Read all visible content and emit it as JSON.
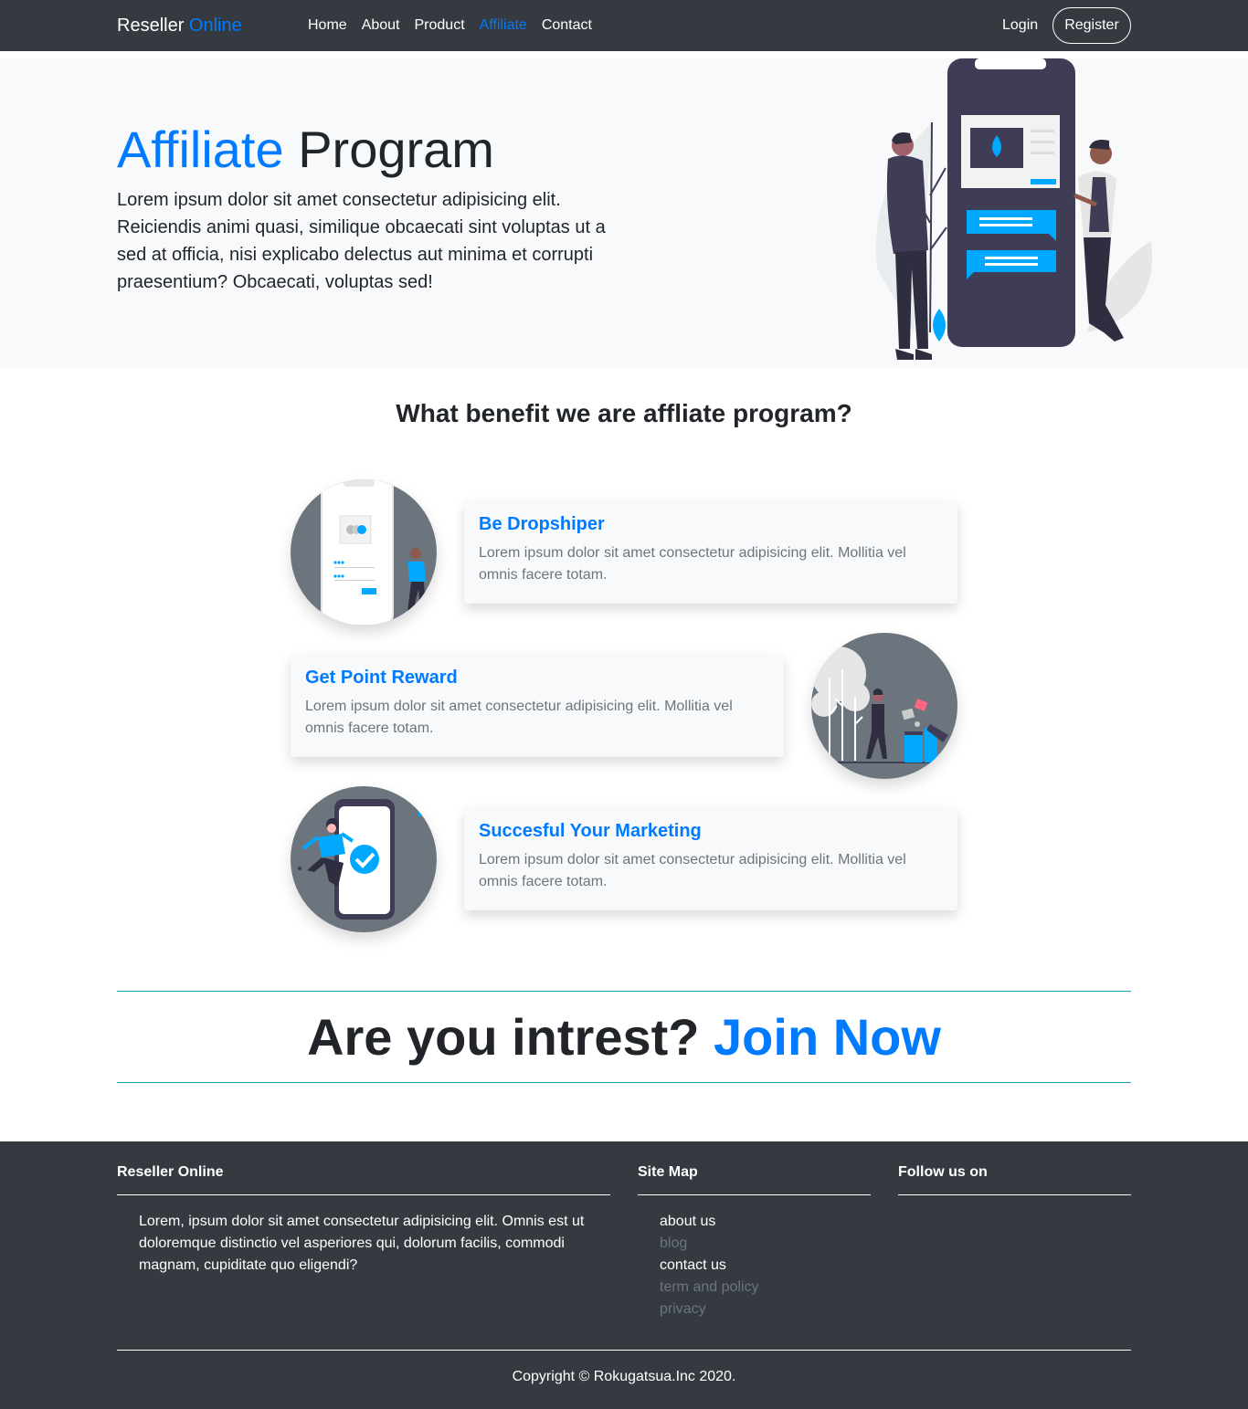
{
  "navbar": {
    "brand_main": "Reseller",
    "brand_accent": "Online",
    "links": [
      {
        "label": "Home",
        "active": false
      },
      {
        "label": "About",
        "active": false
      },
      {
        "label": "Product",
        "active": false
      },
      {
        "label": "Affiliate",
        "active": true
      },
      {
        "label": "Contact",
        "active": false
      }
    ],
    "login_label": "Login",
    "register_label": "Register"
  },
  "hero": {
    "title_accent": "Affiliate",
    "title_rest": "Program",
    "text": "Lorem ipsum dolor sit amet consectetur adipisicing elit. Reiciendis animi quasi, similique obcaecati sint voluptas ut a sed at officia, nisi explicabo delectus aut minima et corrupti praesentium? Obcaecati, voluptas sed!"
  },
  "benefits": {
    "title": "What benefit we are affliate program?",
    "items": [
      {
        "title": "Be Dropshiper",
        "text": "Lorem ipsum dolor sit amet consectetur adipisicing elit. Mollitia vel omnis facere totam."
      },
      {
        "title": "Get Point Reward",
        "text": "Lorem ipsum dolor sit amet consectetur adipisicing elit. Mollitia vel omnis facere totam."
      },
      {
        "title": "Succesful Your Marketing",
        "text": "Lorem ipsum dolor sit amet consectetur adipisicing elit. Mollitia vel omnis facere totam."
      }
    ]
  },
  "cta": {
    "text": "Are you intrest?",
    "link": "Join Now"
  },
  "footer": {
    "about_title": "Reseller Online",
    "about_text": "Lorem, ipsum dolor sit amet consectetur adipisicing elit. Omnis est ut doloremque distinctio vel asperiores qui, dolorum facilis, commodi magnam, cupiditate quo eligendi?",
    "sitemap_title": "Site Map",
    "sitemap_links": [
      {
        "label": "about us",
        "muted": false
      },
      {
        "label": "blog",
        "muted": true
      },
      {
        "label": "contact us",
        "muted": false
      },
      {
        "label": "term and policy",
        "muted": true
      },
      {
        "label": "privacy",
        "muted": true
      }
    ],
    "follow_title": "Follow us on",
    "copyright": "Copyright © Rokugatsua.Inc 2020."
  },
  "colors": {
    "accent": "#007bff",
    "dark": "#343a40",
    "light": "#f8f9fa",
    "illustration_blue": "#00a8ff"
  }
}
